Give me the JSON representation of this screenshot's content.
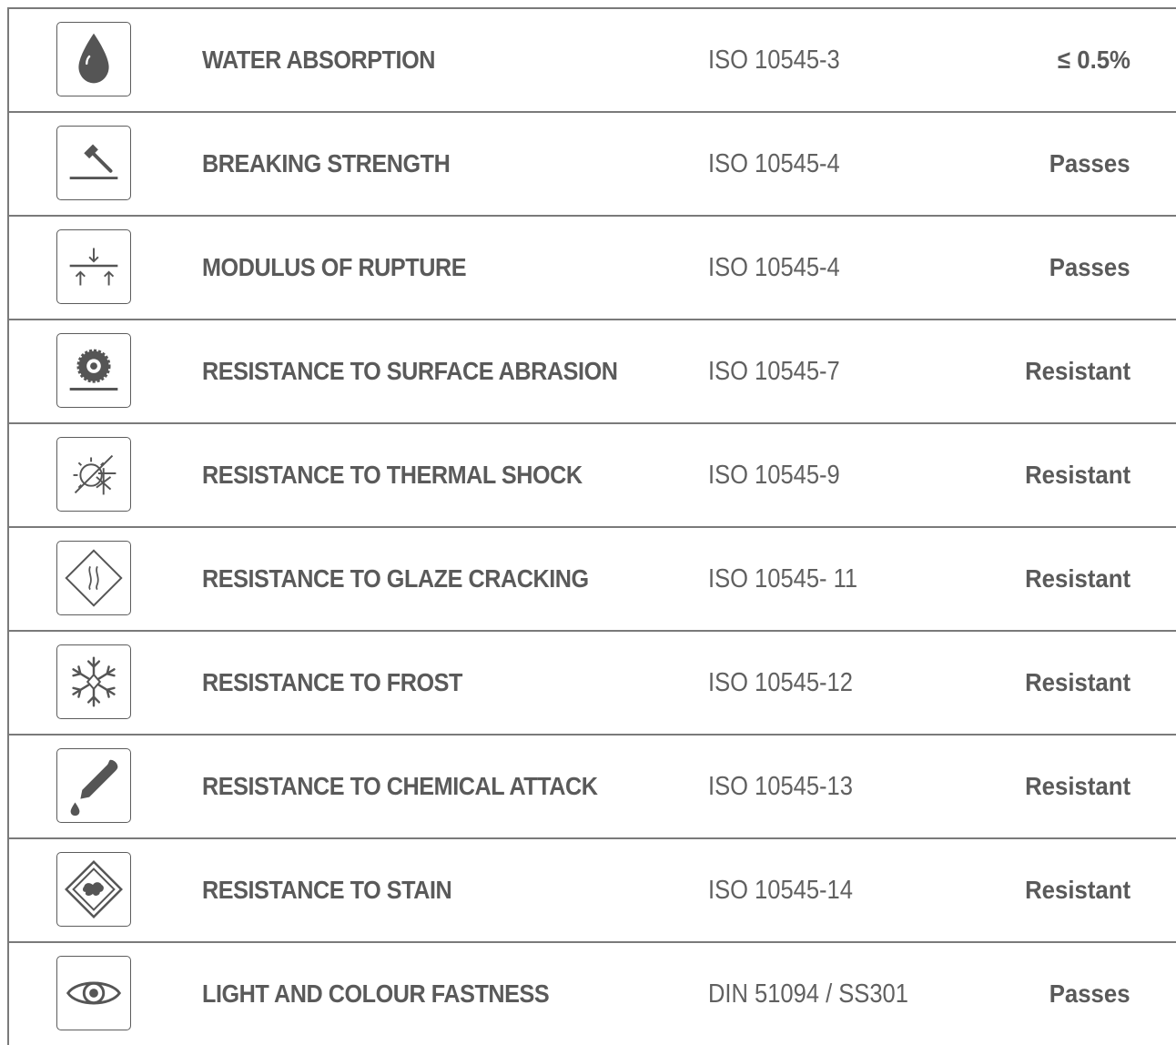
{
  "colors": {
    "icon": "#555555",
    "text": "#5a5a5a",
    "border": "#7a7a7a"
  },
  "rows": [
    {
      "icon": "water-drop-icon",
      "name": "WATER ABSORPTION",
      "standard": "ISO 10545-3",
      "result": "≤ 0.5%"
    },
    {
      "icon": "hammer-icon",
      "name": "BREAKING STRENGTH",
      "standard": "ISO 10545-4",
      "result": "Passes"
    },
    {
      "icon": "rupture-arrows-icon",
      "name": "MODULUS OF RUPTURE",
      "standard": "ISO 10545-4",
      "result": "Passes"
    },
    {
      "icon": "abrasion-disc-icon",
      "name": "RESISTANCE TO SURFACE ABRASION",
      "standard": "ISO 10545-7",
      "result": "Resistant"
    },
    {
      "icon": "thermal-shock-icon",
      "name": "RESISTANCE TO THERMAL SHOCK",
      "standard": "ISO 10545-9",
      "result": "Resistant"
    },
    {
      "icon": "glaze-cracking-icon",
      "name": "RESISTANCE TO GLAZE CRACKING",
      "standard": "ISO 10545- 11",
      "result": "Resistant"
    },
    {
      "icon": "snowflake-icon",
      "name": "RESISTANCE TO FROST",
      "standard": "ISO 10545-12",
      "result": "Resistant"
    },
    {
      "icon": "pipette-icon",
      "name": "RESISTANCE TO CHEMICAL ATTACK",
      "standard": "ISO 10545-13",
      "result": "Resistant"
    },
    {
      "icon": "stain-icon",
      "name": "RESISTANCE TO STAIN",
      "standard": "ISO 10545-14",
      "result": "Resistant"
    },
    {
      "icon": "eye-icon",
      "name": "LIGHT AND COLOUR FASTNESS",
      "standard": "DIN 51094 / SS301",
      "result": "Passes"
    }
  ]
}
